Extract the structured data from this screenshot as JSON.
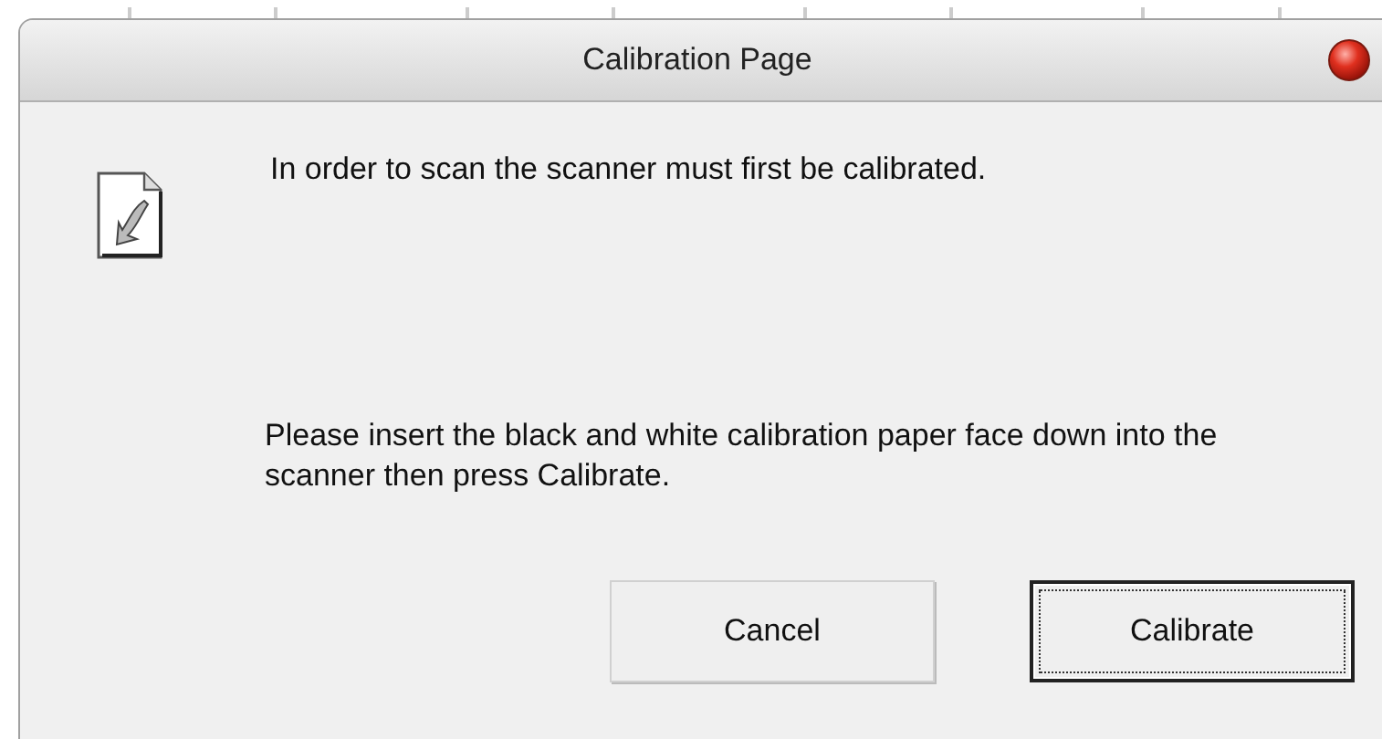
{
  "window": {
    "title": "Calibration Page"
  },
  "message": "In order to scan the scanner must first be calibrated.",
  "instruction": "Please insert the black and white calibration paper face down into the scanner then press Calibrate.",
  "buttons": [
    {
      "label": "Cancel",
      "default": false
    },
    {
      "label": "Calibrate",
      "default": true
    }
  ]
}
